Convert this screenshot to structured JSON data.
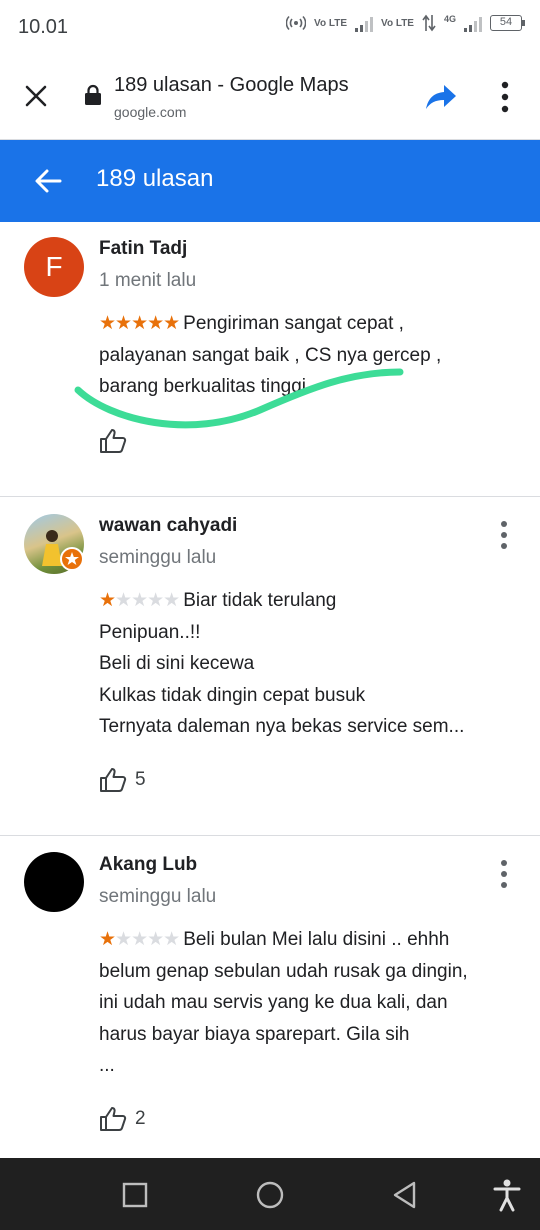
{
  "status_bar": {
    "time": "10.01",
    "volte_1": "Vo LTE",
    "volte_2": "Vo LTE",
    "network": "4G",
    "battery": "54"
  },
  "toolbar": {
    "title": "189 ulasan - Google Maps",
    "url": "google.com",
    "icons": [
      "close-icon",
      "lock-icon",
      "share-icon",
      "more-vert-icon"
    ]
  },
  "app_bar": {
    "title": "189 ulasan",
    "back_icon": "arrow-back-icon"
  },
  "colors": {
    "app_bar": "#1a73e8",
    "star_filled": "#e8710a",
    "star_empty": "#dadce0",
    "highlight_stroke": "#3ddc97",
    "avatar_fatin": "#d84315"
  },
  "reviews": [
    {
      "initial": "F",
      "name": "Fatin Tadj",
      "time": "1 menit lalu",
      "rating": 5,
      "lines": [
        "Pengiriman sangat cepat ,",
        "palayanan sangat baik , CS nya gercep ,",
        "barang berkualitas tinggi"
      ],
      "likes": ""
    },
    {
      "name": "wawan cahyadi",
      "time": "seminggu lalu",
      "rating": 1,
      "lines": [
        "Biar tidak terulang",
        "Penipuan..!!",
        "Beli di sini kecewa",
        "Kulkas tidak dingin cepat busuk",
        "Ternyata daleman nya bekas service sem..."
      ],
      "likes": "5"
    },
    {
      "name": "Akang Lub",
      "time": "seminggu lalu",
      "rating": 1,
      "lines": [
        "Beli bulan Mei lalu disini .. ehhh",
        "belum genap sebulan udah rusak ga dingin,",
        "ini udah mau servis yang ke dua kali, dan",
        "harus bayar biaya sparepart. Gila sih",
        "..."
      ],
      "likes": "2"
    }
  ],
  "nav_bar": {
    "icons": [
      "recents-icon",
      "home-icon",
      "back-icon",
      "accessibility-icon"
    ]
  }
}
